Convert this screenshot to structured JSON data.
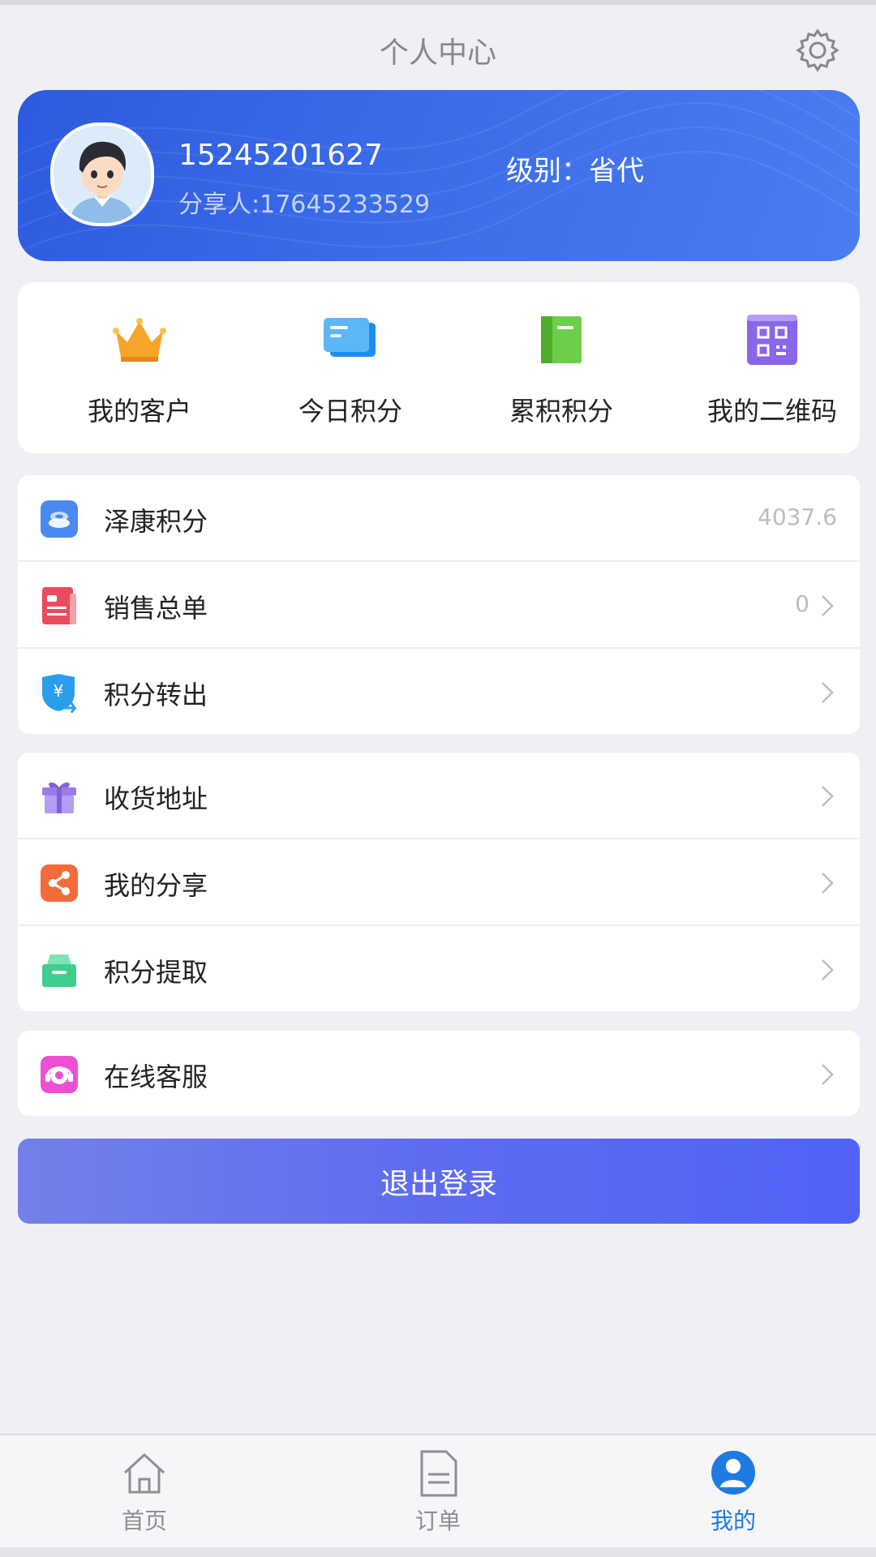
{
  "header": {
    "title": "个人中心",
    "settings_icon": "gear-icon"
  },
  "profile": {
    "phone": "15245201627",
    "sharer": "分享人:17645233529",
    "level": "级别：省代",
    "colors": {
      "card_start": "#2E5ADF",
      "card_end": "#4C7CF1"
    }
  },
  "quick_actions": [
    {
      "label": "我的客户",
      "icon": "crown-icon"
    },
    {
      "label": "今日积分",
      "icon": "cards-icon"
    },
    {
      "label": "累积积分",
      "icon": "book-icon"
    },
    {
      "label": "我的二维码",
      "icon": "qr-code-icon"
    }
  ],
  "menu_group_1": [
    {
      "label": "泽康积分",
      "value": "4037.6",
      "icon": "coins-icon"
    },
    {
      "label": "销售总单",
      "value": "0",
      "icon": "document-icon"
    },
    {
      "label": "积分转出",
      "value": "",
      "icon": "shield-yen-icon"
    }
  ],
  "menu_group_2": [
    {
      "label": "收货地址",
      "icon": "gift-icon"
    },
    {
      "label": "我的分享",
      "icon": "share-icon"
    },
    {
      "label": "积分提取",
      "icon": "tray-icon"
    }
  ],
  "menu_group_3": [
    {
      "label": "在线客服",
      "icon": "headset-icon"
    }
  ],
  "logout_label": "退出登录",
  "tabbar": [
    {
      "label": "首页",
      "icon": "home-icon",
      "active": false
    },
    {
      "label": "订单",
      "icon": "order-icon",
      "active": false
    },
    {
      "label": "我的",
      "icon": "user-icon",
      "active": true
    }
  ],
  "colors": {
    "accent": "#1E7CE0",
    "logout_button": "#5D6CF0",
    "background": "#EFEFF5"
  }
}
